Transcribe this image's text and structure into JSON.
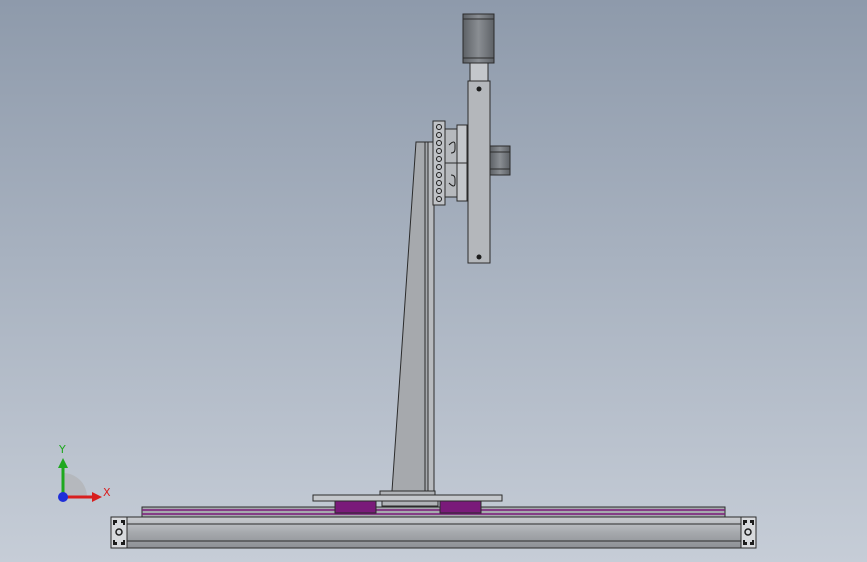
{
  "viewport": {
    "background_top": "#8e9aab",
    "background_bottom": "#c6cdd7"
  },
  "triad": {
    "x_label": "X",
    "y_label": "Y",
    "x_color": "#d81e1e",
    "y_color": "#1ea81e",
    "z_color": "#1e2ed8"
  },
  "model": {
    "part_fill": "#a6a9ad",
    "part_stroke": "#2b2b2b",
    "rail_highlight": "#c9ccd0",
    "accent_purple": "#7a1a7a",
    "motor_fill": "#6f7378"
  }
}
